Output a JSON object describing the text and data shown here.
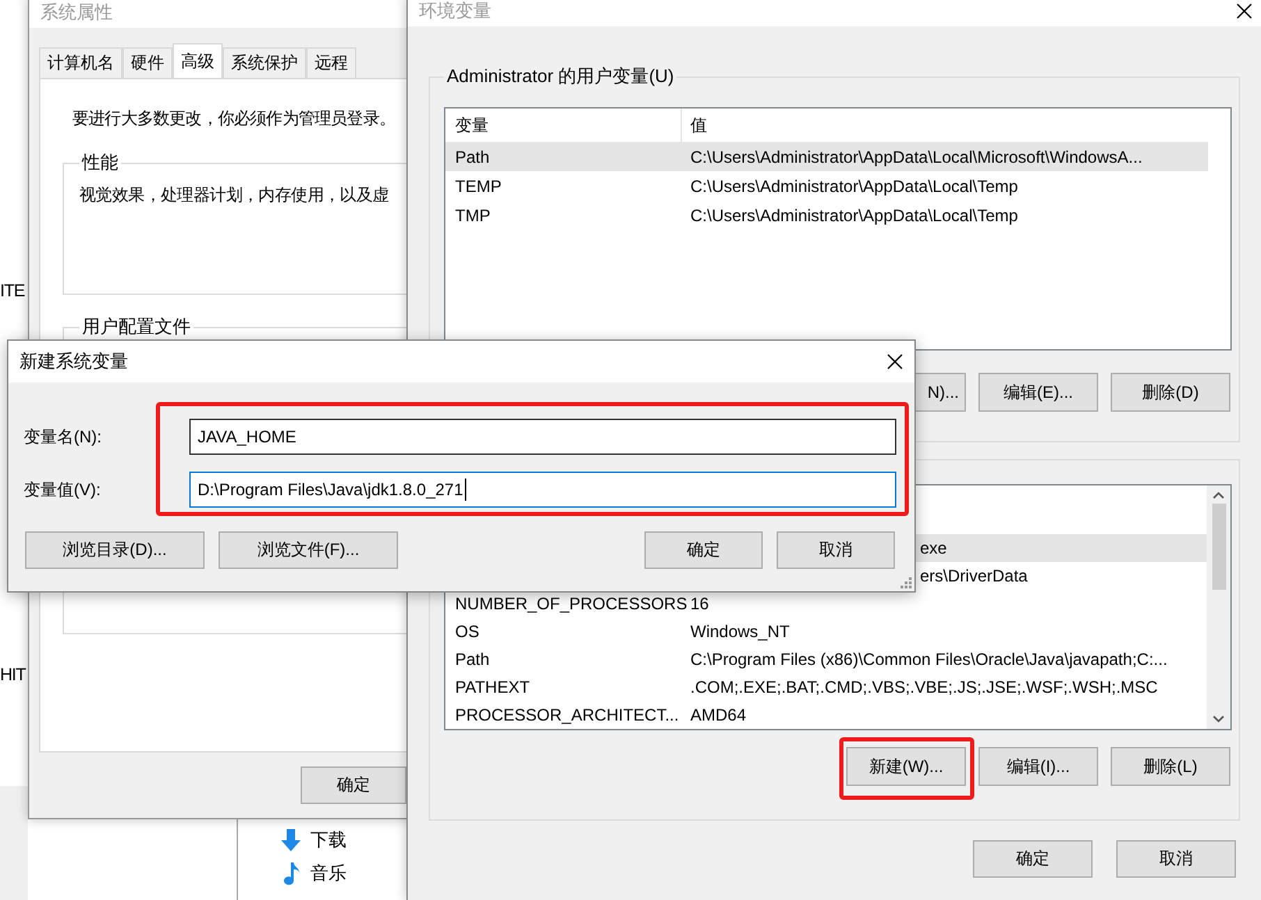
{
  "background": {
    "fragments": [
      "ITE",
      "HIT"
    ]
  },
  "system_properties": {
    "title": "系统属性",
    "tabs": [
      {
        "label": "计算机名",
        "selected": false
      },
      {
        "label": "硬件",
        "selected": false
      },
      {
        "label": "高级",
        "selected": true
      },
      {
        "label": "系统保护",
        "selected": false
      },
      {
        "label": "远程",
        "selected": false
      }
    ],
    "notice": "要进行大多数更改，你必须作为管理员登录。",
    "performance": {
      "label": "性能",
      "text": "视觉效果，处理器计划，内存使用，以及虚"
    },
    "user_profiles": {
      "label": "用户配置文件"
    },
    "buttons": [
      "确定"
    ]
  },
  "explorer_sidebar": {
    "items": [
      {
        "label": "下载",
        "kind": "download"
      },
      {
        "label": "音乐",
        "kind": "music"
      }
    ]
  },
  "environment_variables": {
    "title": "环境变量",
    "user_variables": {
      "label": "Administrator 的用户变量(U)",
      "columns": [
        "变量",
        "值"
      ],
      "rows": [
        {
          "name": "Path",
          "value": "C:\\Users\\Administrator\\AppData\\Local\\Microsoft\\WindowsA...",
          "selected": true
        },
        {
          "name": "TEMP",
          "value": "C:\\Users\\Administrator\\AppData\\Local\\Temp",
          "selected": false
        },
        {
          "name": "TMP",
          "value": "C:\\Users\\Administrator\\AppData\\Local\\Temp",
          "selected": false
        }
      ],
      "buttons": [
        {
          "label": "N)...",
          "kind": "covered"
        },
        {
          "label": "编辑(E)...",
          "kind": "plain"
        },
        {
          "label": "删除(D)",
          "kind": "plain"
        }
      ]
    },
    "system_variables": {
      "rows": [
        {
          "kind": "covered",
          "value": "exe",
          "selected": true
        },
        {
          "kind": "covered",
          "value": "ers\\DriverData",
          "selected": false
        },
        {
          "kind": "plain",
          "name": "NUMBER_OF_PROCESSORS",
          "value": "16",
          "selected": false
        },
        {
          "kind": "plain",
          "name": "OS",
          "value": "Windows_NT",
          "selected": false
        },
        {
          "kind": "plain",
          "name": "Path",
          "value": "C:\\Program Files (x86)\\Common Files\\Oracle\\Java\\javapath;C:...",
          "selected": false
        },
        {
          "kind": "plain",
          "name": "PATHEXT",
          "value": ".COM;.EXE;.BAT;.CMD;.VBS;.VBE;.JS;.JSE;.WSF;.WSH;.MSC",
          "selected": false
        },
        {
          "kind": "plain",
          "name": "PROCESSOR_ARCHITECT...",
          "value": "AMD64",
          "selected": false
        }
      ],
      "buttons": [
        {
          "label": "新建(W)...",
          "highlighted": true
        },
        {
          "label": "编辑(I)...",
          "highlighted": false
        },
        {
          "label": "删除(L)",
          "highlighted": false
        }
      ]
    },
    "buttons": [
      "确定",
      "取消"
    ]
  },
  "new_variable_dialog": {
    "title": "新建系统变量",
    "fields_highlighted": true,
    "fields": [
      {
        "label": "变量名(N):",
        "value": "JAVA_HOME",
        "focused": false
      },
      {
        "label": "变量值(V):",
        "value": "D:\\Program Files\\Java\\jdk1.8.0_271",
        "focused": true
      }
    ],
    "buttons": [
      "浏览目录(D)...",
      "浏览文件(F)...",
      "确定",
      "取消"
    ]
  }
}
